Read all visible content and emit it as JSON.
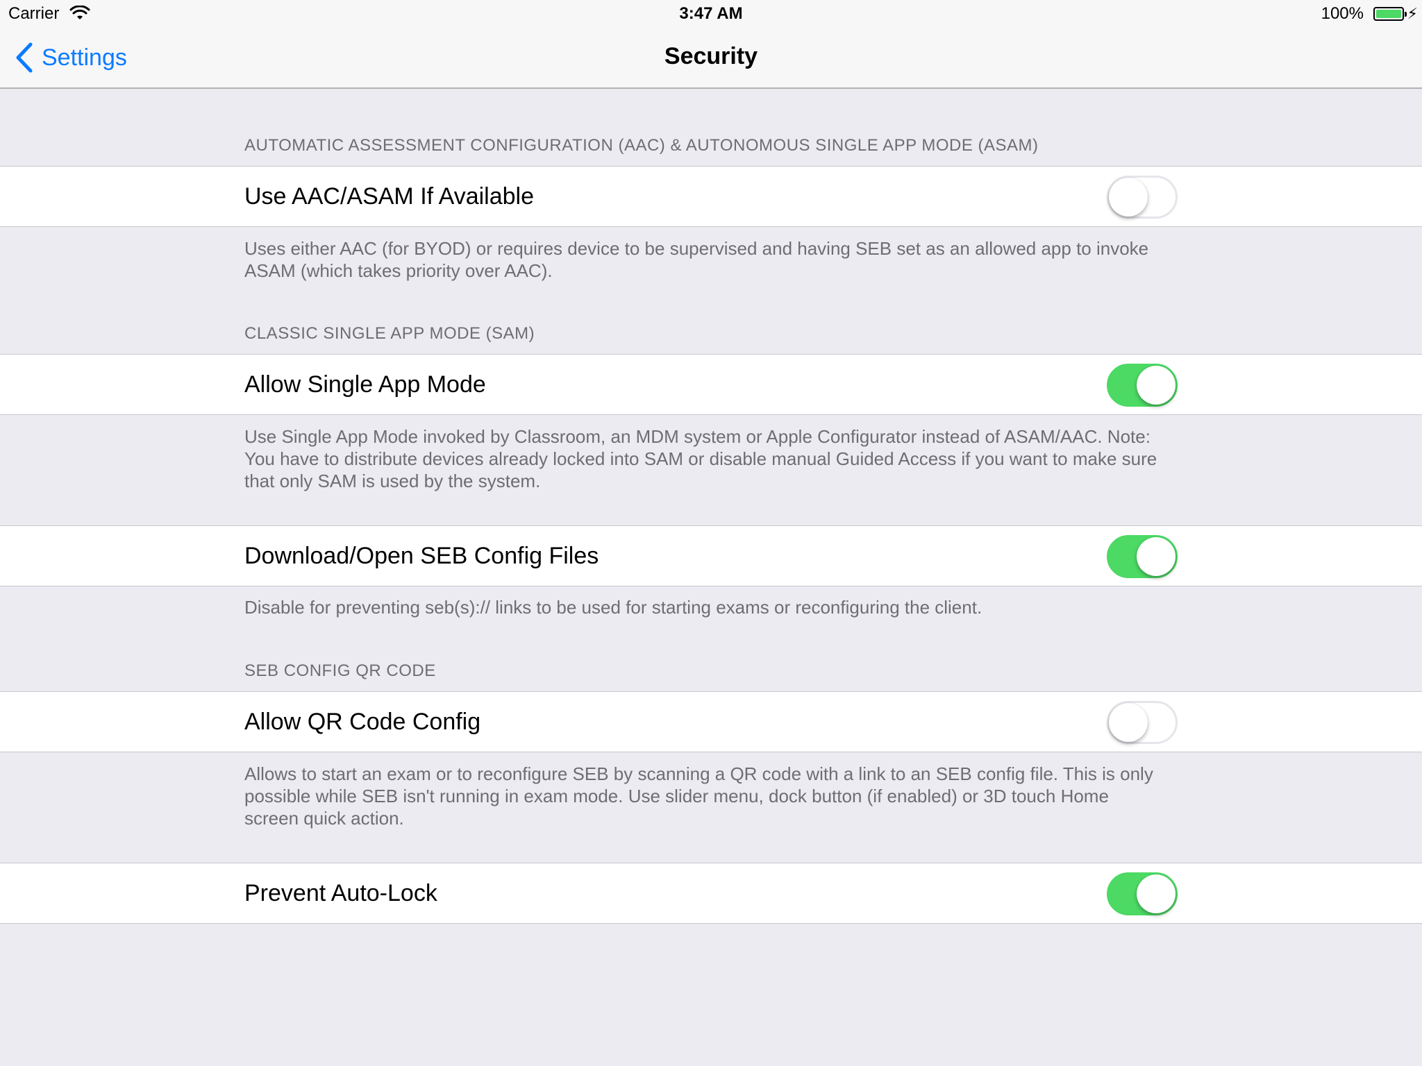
{
  "status_bar": {
    "carrier": "Carrier",
    "time": "3:47 AM",
    "battery_percent": "100%",
    "battery_level": 1.0,
    "battery_color": "#4cd964",
    "wifi_icon": "wifi-icon",
    "charging_icon": "bolt-icon"
  },
  "nav_bar": {
    "back_label": "Settings",
    "back_icon": "chevron-left-icon",
    "title": "Security",
    "accent_color": "#0a7bff"
  },
  "sections": [
    {
      "header": "AUTOMATIC ASSESSMENT CONFIGURATION (AAC) & AUTONOMOUS SINGLE APP MODE (ASAM)",
      "label": "Use AAC/ASAM If Available",
      "enabled": false,
      "footer": "Uses either AAC (for BYOD) or requires device to be supervised and having SEB set as an allowed app to invoke ASAM (which takes priority over AAC)."
    },
    {
      "header": "CLASSIC SINGLE APP MODE (SAM)",
      "label": "Allow Single App Mode",
      "enabled": true,
      "footer": "Use Single App Mode invoked by Classroom, an MDM system or Apple Configurator instead of ASAM/AAC. Note: You have to distribute devices already locked into SAM or disable manual Guided Access if you want to make sure that only SAM is used by the system."
    },
    {
      "header": "",
      "label": "Download/Open SEB Config Files",
      "enabled": true,
      "footer": "Disable for preventing seb(s):// links to be used for starting exams or reconfiguring the client."
    },
    {
      "header": "SEB CONFIG QR CODE",
      "label": "Allow QR Code Config",
      "enabled": false,
      "footer": "Allows to start an exam or to reconfigure SEB by scanning a QR code with a link to an SEB config file. This is only possible while SEB isn't running in exam mode. Use slider menu, dock button (if enabled) or 3D touch Home screen quick action."
    },
    {
      "header": "",
      "label": "Prevent Auto-Lock",
      "enabled": true,
      "footer": ""
    }
  ],
  "colors": {
    "toggle_on": "#4cd964",
    "background": "#ebebf1",
    "secondary_text": "#6d6d72"
  }
}
